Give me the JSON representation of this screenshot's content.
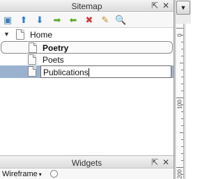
{
  "sitemap": {
    "title": "Sitemap",
    "pin_icon": "⇱",
    "close_icon": "✕",
    "toolbar": [
      {
        "name": "add-page-button",
        "icon": "add-page-icon",
        "glyph": "▣"
      },
      {
        "name": "move-up-button",
        "icon": "arrow-up-icon",
        "glyph": "⬆"
      },
      {
        "name": "move-down-button",
        "icon": "arrow-down-icon",
        "glyph": "⬇"
      },
      {
        "name": "indent-button",
        "icon": "arrow-right-icon",
        "glyph": "➡"
      },
      {
        "name": "outdent-button",
        "icon": "arrow-left-icon",
        "glyph": "⬅"
      },
      {
        "name": "delete-page-button",
        "icon": "delete-page-icon",
        "glyph": "✖"
      },
      {
        "name": "edit-page-button",
        "icon": "edit-page-icon",
        "glyph": "✎"
      },
      {
        "name": "search-button",
        "icon": "search-icon",
        "glyph": "🔍"
      }
    ],
    "tree": {
      "root": {
        "label": "Home",
        "expander_glyph": "▼",
        "expanded": true
      },
      "children": [
        {
          "label": "Poetry",
          "state": "focused"
        },
        {
          "label": "Poets",
          "state": "normal"
        },
        {
          "label": "Publications",
          "state": "editing"
        }
      ]
    }
  },
  "widgets": {
    "title": "Widgets",
    "library_label": "Wireframe",
    "library_caret": "▾"
  },
  "ruler": {
    "menu_glyph": "▼",
    "labels": [
      "0",
      "100",
      "200"
    ]
  }
}
